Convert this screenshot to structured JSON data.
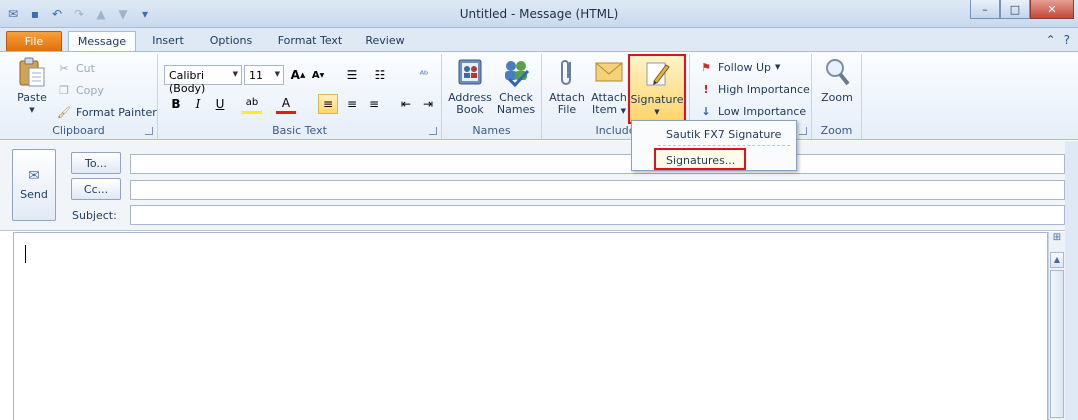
{
  "window": {
    "title": "Untitled  -  Message (HTML)",
    "minimize": "–",
    "maximize": "□",
    "close": "✕"
  },
  "qat": {
    "icons": [
      "outlook-icon",
      "save-icon",
      "undo-icon",
      "redo-icon",
      "up-icon",
      "down-icon",
      "customize-icon"
    ]
  },
  "tabs": [
    "File",
    "Message",
    "Insert",
    "Options",
    "Format Text",
    "Review"
  ],
  "active_tab": "Message",
  "ribbon": {
    "clipboard": {
      "label": "Clipboard",
      "paste": "Paste",
      "cut": "Cut",
      "copy": "Copy",
      "format_painter": "Format Painter"
    },
    "basic_text": {
      "label": "Basic Text",
      "font": "Calibri (Body)",
      "size": "11"
    },
    "names": {
      "label": "Names",
      "address_book": [
        "Address",
        "Book"
      ],
      "check_names": [
        "Check",
        "Names"
      ]
    },
    "include": {
      "label": "Include",
      "attach_file": [
        "Attach",
        "File"
      ],
      "attach_item": [
        "Attach",
        "Item"
      ],
      "signature": "Signature"
    },
    "tags": {
      "follow_up": "Follow Up",
      "high_importance": "High Importance",
      "low_importance": "Low Importance"
    },
    "zoom": {
      "label": "Zoom",
      "button": "Zoom"
    }
  },
  "signature_menu": {
    "items": [
      "Sautik FX7 Signature",
      "Signatures..."
    ]
  },
  "header": {
    "send": "Send",
    "to": "To...",
    "cc": "Cc...",
    "subject": "Subject:",
    "to_value": "",
    "cc_value": "",
    "subject_value": ""
  },
  "colors": {
    "file_tab": "#e16e0b",
    "highlight_box": "#e10f1f",
    "ribbon_bg": "#e6eef8"
  }
}
